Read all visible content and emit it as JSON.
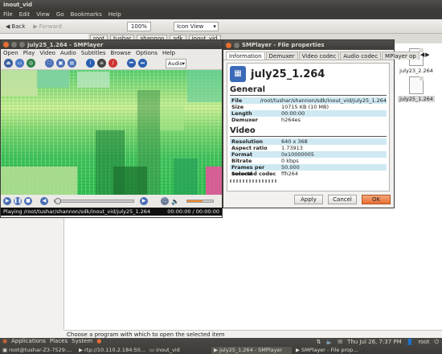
{
  "nautilus": {
    "title": "inout_vid",
    "menu": [
      "File",
      "Edit",
      "View",
      "Go",
      "Bookmarks",
      "Help"
    ],
    "back_label": "Back",
    "forward_label": "Forward",
    "zoom": "100%",
    "view_mode": "Icon View",
    "pathbar": [
      "root",
      "tushar",
      "shannon",
      "sdk",
      "inout_vid"
    ],
    "status": "Choose a program with which to open the selected item",
    "files": [
      {
        "name": "july23_2.264"
      },
      {
        "name": "july25_1.264",
        "selected": true
      }
    ]
  },
  "smplayer": {
    "title": "july25_1.264 - SMPlayer",
    "menu": [
      "Open",
      "Play",
      "Video",
      "Audio",
      "Subtitles",
      "Browse",
      "Options",
      "Help"
    ],
    "audio_select": "Audio",
    "status_left": "Playing /root/tushar/shannon/sdk/inout_vid/july25_1.264",
    "status_right": "00:00:00 / 00:00:00"
  },
  "dialog": {
    "title": "SMPlayer - File properties",
    "tabs": [
      "Information",
      "Demuxer",
      "Video codec",
      "Audio codec",
      "MPlayer op"
    ],
    "active_tab": "Information",
    "filename": "july25_1.264",
    "general_title": "General",
    "general": [
      {
        "key": "File",
        "value": "/root/tushar/shannon/sdk/inout_vid/july25_1.264"
      },
      {
        "key": "Size",
        "value": "10715 KB (10 MB)"
      },
      {
        "key": "Length",
        "value": "00:00:00"
      },
      {
        "key": "Demuxer",
        "value": "h264es"
      }
    ],
    "video_title": "Video",
    "video": [
      {
        "key": "Resolution",
        "value": "640 x 368"
      },
      {
        "key": "Aspect ratio",
        "value": "1.73913"
      },
      {
        "key": "Format",
        "value": "0x10000005"
      },
      {
        "key": "Bitrate",
        "value": "0 kbps"
      },
      {
        "key": "Frames per second",
        "value": "50.000"
      },
      {
        "key": "Selected codec",
        "value": "ffh264"
      }
    ],
    "apply_label": "Apply",
    "cancel_label": "Cancel",
    "ok_label": "OK"
  },
  "panel": {
    "menu": [
      "Applications",
      "Places",
      "System"
    ],
    "datetime": "Thu Jul 26,  7:37 PM",
    "user": "root",
    "tasks": [
      {
        "label": "root@tushar-Z3-7529:..."
      },
      {
        "label": "rtp://10.110.2.184:50..."
      },
      {
        "label": "inout_vid"
      },
      {
        "label": "july25_1.264 - SMPlayer",
        "active": true
      },
      {
        "label": "SMPlayer - File prop..."
      }
    ]
  }
}
